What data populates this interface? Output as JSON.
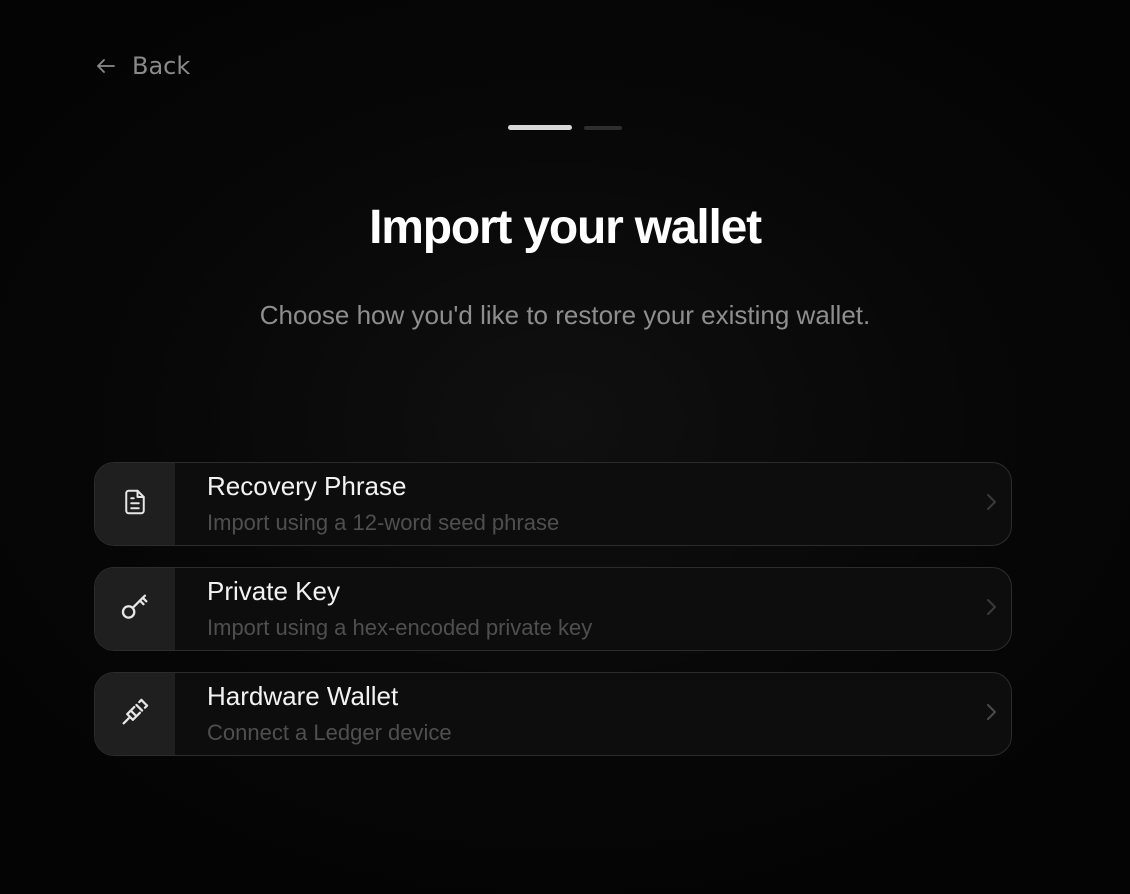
{
  "header": {
    "back_label": "Back"
  },
  "progress": {
    "current_step": 1,
    "total_steps": 2
  },
  "main": {
    "title": "Import your wallet",
    "subtitle": "Choose how you'd like to restore your existing wallet."
  },
  "options": [
    {
      "label": "Recovery Phrase",
      "description": "Import using a 12-word seed phrase",
      "icon": "document-icon"
    },
    {
      "label": "Private Key",
      "description": "Import using a hex-encoded private key",
      "icon": "key-icon"
    },
    {
      "label": "Hardware Wallet",
      "description": "Connect a Ledger device",
      "icon": "usb-plug-icon"
    }
  ],
  "colors": {
    "background": "#050505",
    "card_background": "#0d0d0d",
    "card_border": "#2c2c2c",
    "icon_box": "#1f1f1f",
    "title": "#ffffff",
    "subtitle": "#8e8e8e",
    "description": "#4f4f4f",
    "progress_active": "#d8d8d8",
    "progress_inactive": "#2e2e2e"
  }
}
